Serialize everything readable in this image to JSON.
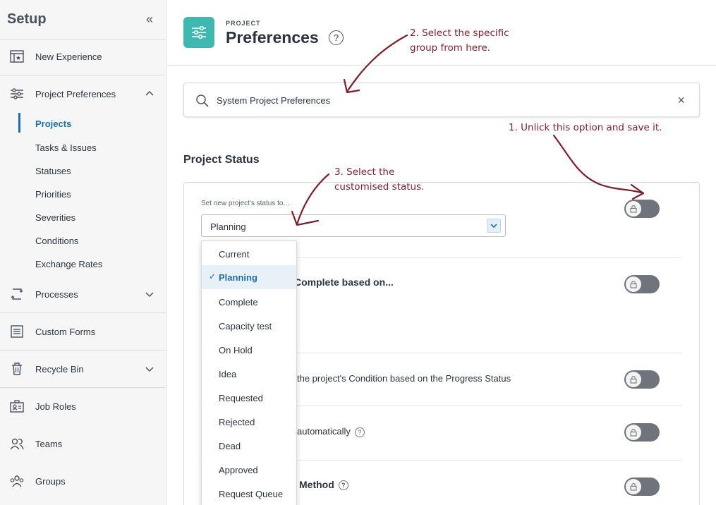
{
  "sidebar": {
    "title": "Setup",
    "items": [
      {
        "label": "New Experience",
        "icon": "new-experience-icon"
      },
      {
        "label": "Project Preferences",
        "icon": "sliders-icon"
      },
      {
        "label": "Processes",
        "icon": "process-icon"
      },
      {
        "label": "Custom Forms",
        "icon": "custom-forms-icon"
      },
      {
        "label": "Recycle Bin",
        "icon": "recycle-bin-icon"
      },
      {
        "label": "Job Roles",
        "icon": "job-roles-icon"
      },
      {
        "label": "Teams",
        "icon": "teams-icon"
      },
      {
        "label": "Groups",
        "icon": "groups-icon"
      }
    ],
    "subitems": [
      "Projects",
      "Tasks & Issues",
      "Statuses",
      "Priorities",
      "Severities",
      "Conditions",
      "Exchange Rates"
    ],
    "active_subitem": "Projects"
  },
  "header": {
    "kicker": "PROJECT",
    "title": "Preferences",
    "help": "?"
  },
  "search": {
    "value": "System Project Preferences",
    "clear": "×"
  },
  "section": {
    "title": "Project Status"
  },
  "status_field": {
    "label": "Set new project's status to...",
    "value": "Planning"
  },
  "rows": {
    "row2": "Complete based on...",
    "row3": "the project's Condition based on the Progress Status",
    "row4": "automatically",
    "row5": "Method"
  },
  "dropdown": {
    "options": [
      "Current",
      "Planning",
      "Complete",
      "Capacity test",
      "On Hold",
      "Idea",
      "Requested",
      "Rejected",
      "Dead",
      "Approved",
      "Request Queue"
    ],
    "selected": "Planning"
  },
  "annotations": {
    "a1": "1. Unlick this option and save it.",
    "a2_line1": "2. Select the specific",
    "a2_line2": "group from here.",
    "a3_line1": "3. Select the",
    "a3_line2": "customised status."
  },
  "colors": {
    "accent": "#1d6fa8",
    "brand_tile": "#3fb8af",
    "annotation": "#7a1f2b",
    "toggle_off": "#6f747c"
  }
}
